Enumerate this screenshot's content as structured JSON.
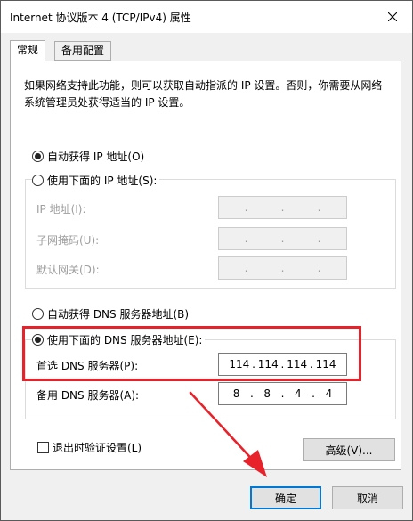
{
  "window": {
    "title": "Internet 协议版本 4 (TCP/IPv4) 属性",
    "close_icon": "close-icon"
  },
  "tabs": [
    {
      "label": "常规",
      "active": true
    },
    {
      "label": "备用配置",
      "active": false
    }
  ],
  "description": "如果网络支持此功能，则可以获取自动指派的 IP 设置。否则，你需要从网络系统管理员处获得适当的 IP 设置。",
  "ip": {
    "auto_label": "自动获得 IP 地址(O)",
    "auto_selected": true,
    "manual_label": "使用下面的 IP 地址(S):",
    "manual_selected": false,
    "address_label": "IP 地址(I):",
    "subnet_label": "子网掩码(U):",
    "gateway_label": "默认网关(D):",
    "address_value": [
      ".",
      ".",
      "."
    ],
    "subnet_value": [
      ".",
      ".",
      "."
    ],
    "gateway_value": [
      ".",
      ".",
      "."
    ]
  },
  "dns": {
    "auto_label": "自动获得 DNS 服务器地址(B)",
    "auto_selected": false,
    "manual_label": "使用下面的 DNS 服务器地址(E):",
    "manual_selected": true,
    "preferred_label": "首选 DNS 服务器(P):",
    "preferred_value": [
      "114",
      ".",
      "114",
      ".",
      "114",
      ".",
      "114"
    ],
    "alternate_label": "备用 DNS 服务器(A):",
    "alternate_value": [
      "8",
      ".",
      "8",
      ".",
      "4",
      ".",
      "4"
    ]
  },
  "validate_label": "退出时验证设置(L)",
  "validate_checked": false,
  "buttons": {
    "advanced": "高级(V)...",
    "ok": "确定",
    "cancel": "取消"
  },
  "colors": {
    "annotation": "#e8222b",
    "default_button_border": "#0078d7",
    "disabled_text": "#9e9e9e"
  }
}
